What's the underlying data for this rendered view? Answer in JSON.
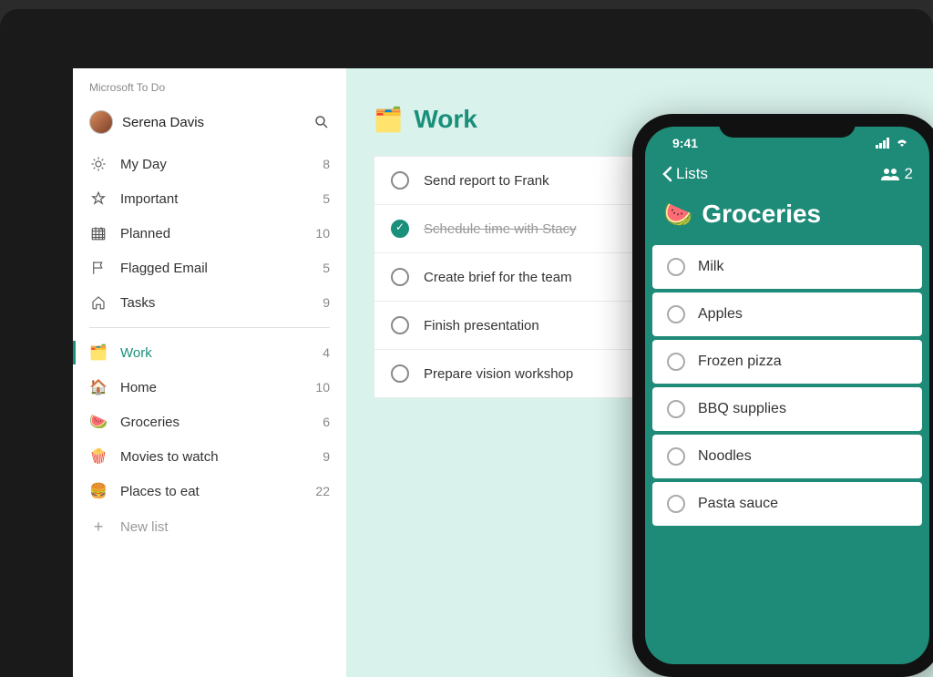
{
  "app": {
    "name": "Microsoft To Do"
  },
  "profile": {
    "name": "Serena Davis"
  },
  "smartLists": [
    {
      "icon": "sun",
      "label": "My Day",
      "count": "8"
    },
    {
      "icon": "star",
      "label": "Important",
      "count": "5"
    },
    {
      "icon": "calendar",
      "label": "Planned",
      "count": "10"
    },
    {
      "icon": "flag",
      "label": "Flagged Email",
      "count": "5"
    },
    {
      "icon": "home",
      "label": "Tasks",
      "count": "9"
    }
  ],
  "customLists": [
    {
      "emoji": "🗂️",
      "label": "Work",
      "count": "4",
      "active": true
    },
    {
      "emoji": "🏠",
      "label": "Home",
      "count": "10"
    },
    {
      "emoji": "🍉",
      "label": "Groceries",
      "count": "6"
    },
    {
      "emoji": "🍿",
      "label": "Movies to watch",
      "count": "9"
    },
    {
      "emoji": "🍔",
      "label": "Places to eat",
      "count": "22"
    }
  ],
  "newList": {
    "label": "New list"
  },
  "main": {
    "emoji": "🗂️",
    "title": "Work",
    "tasks": [
      {
        "text": "Send report to Frank",
        "done": false
      },
      {
        "text": "Schedule time with Stacy",
        "done": true
      },
      {
        "text": "Create brief for the team",
        "done": false
      },
      {
        "text": "Finish presentation",
        "done": false
      },
      {
        "text": "Prepare vision workshop",
        "done": false
      }
    ]
  },
  "phone": {
    "time": "9:41",
    "backLabel": "Lists",
    "shareCount": "2",
    "list": {
      "emoji": "🍉",
      "title": "Groceries",
      "items": [
        {
          "text": "Milk"
        },
        {
          "text": "Apples"
        },
        {
          "text": "Frozen pizza"
        },
        {
          "text": "BBQ supplies"
        },
        {
          "text": "Noodles"
        },
        {
          "text": "Pasta sauce"
        }
      ]
    }
  }
}
